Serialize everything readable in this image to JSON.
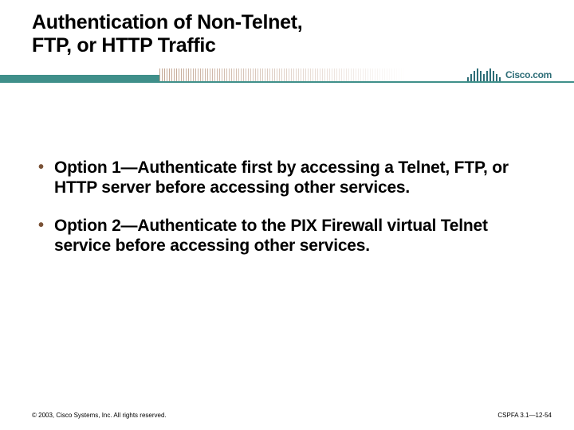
{
  "title": {
    "line1": "Authentication of Non-Telnet,",
    "line2": "FTP, or HTTP Traffic"
  },
  "brand": {
    "name": "Cisco.com"
  },
  "bullets": [
    "Option 1—Authenticate first by accessing a Telnet, FTP, or HTTP server before accessing other services.",
    "Option 2—Authenticate to the PIX Firewall virtual Telnet service before accessing other services."
  ],
  "footer": {
    "copyright": "© 2003, Cisco Systems, Inc. All rights reserved.",
    "code": "CSPFA 3.1—12-54"
  }
}
